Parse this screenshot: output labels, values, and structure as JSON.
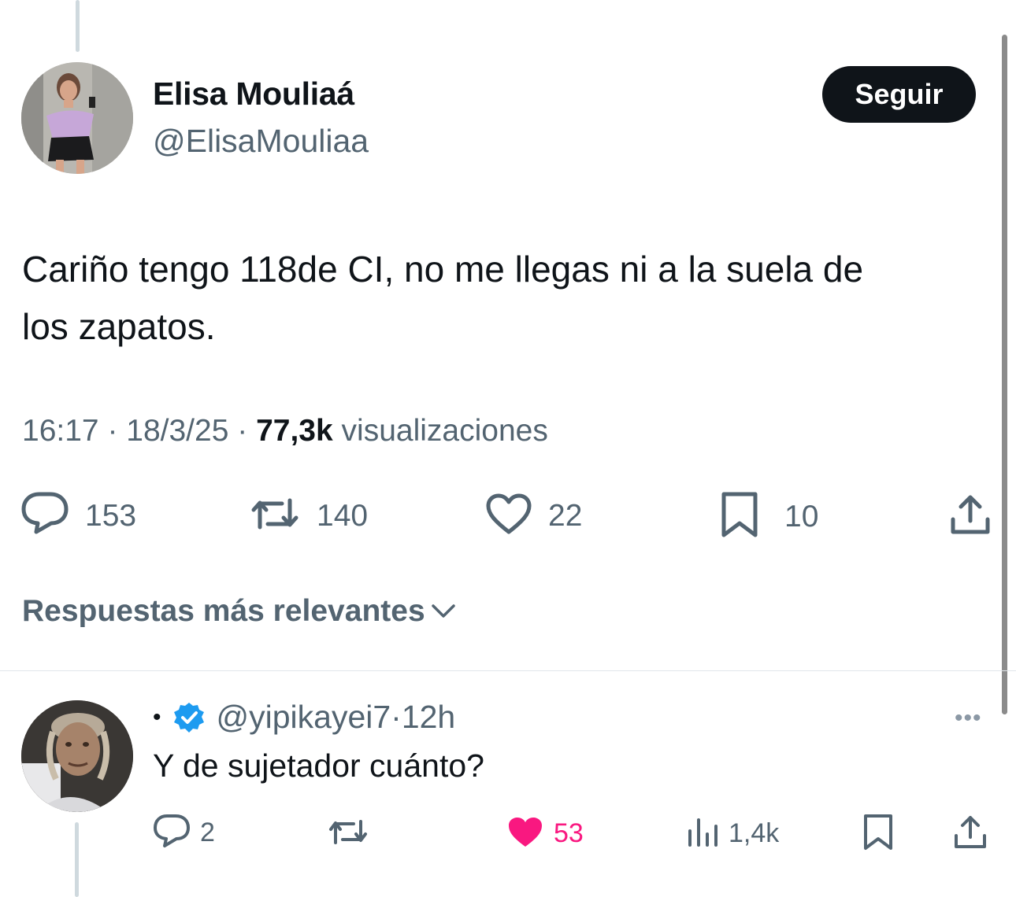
{
  "tweet": {
    "author": {
      "name": "Elisa Mouliaá",
      "handle": "@ElisaMouliaa"
    },
    "follow_label": "Seguir",
    "text_line1": "Cariño tengo 118de CI, no me llegas ni a la suela de",
    "text_line2": "los zapatos.",
    "time": "16:17",
    "sep1": " · ",
    "date": "18/3/25",
    "sep2": " · ",
    "views_count": "77,3k",
    "views_label": " visualizaciones",
    "actions": {
      "replies": "153",
      "retweets": "140",
      "likes": "22",
      "bookmarks": "10"
    }
  },
  "sort": {
    "label": "Respuestas más relevantes"
  },
  "reply": {
    "bullet": "•",
    "handle": "@yipikayei7",
    "sep": " · ",
    "time": "12h",
    "more": "•••",
    "text": "Y de sujetador cuánto?",
    "actions": {
      "replies": "2",
      "likes": "53",
      "views": "1,4k"
    },
    "like_color": "#f91880"
  },
  "icons": {
    "reply": "reply-icon",
    "retweet": "retweet-icon",
    "like": "heart-icon",
    "bookmark": "bookmark-icon",
    "share": "share-icon",
    "views": "views-icon",
    "verified": "verified-badge-icon",
    "chevron": "chevron-down-icon"
  },
  "colors": {
    "text": "#0f1419",
    "muted": "#536471",
    "verified": "#1d9bf0",
    "follow_bg": "#0f1419"
  }
}
